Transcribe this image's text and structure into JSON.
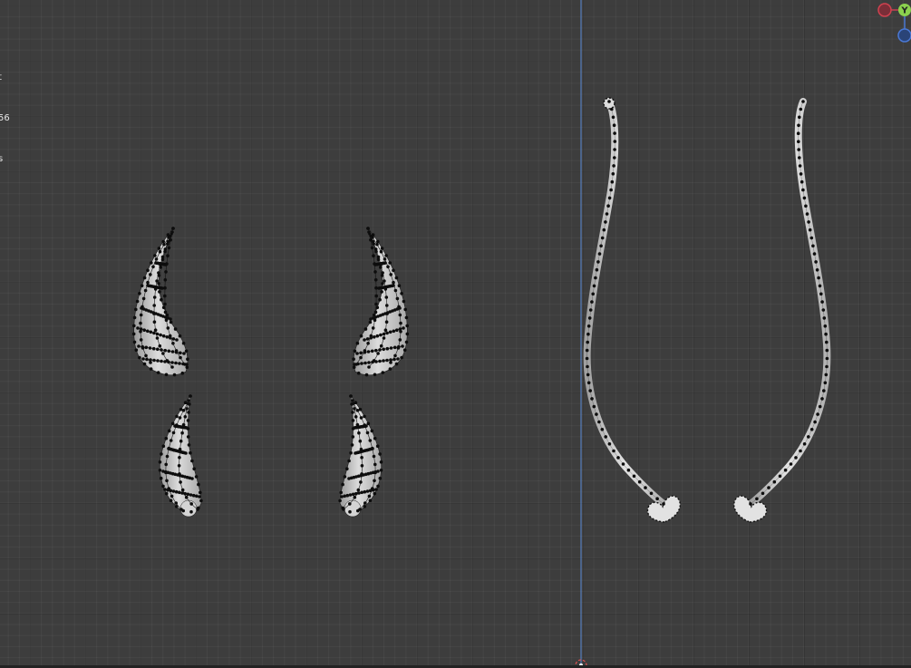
{
  "viewport": {
    "background_color": "#3d3d3d",
    "axis_line_color": "#5a8bd6",
    "view_axis": "Y"
  },
  "stats_overlay": {
    "lines": [
      "t",
      "56",
      "s"
    ]
  },
  "navigation_gizmo": {
    "axis_label": "Y",
    "x_color": "#d0414f",
    "y_color": "#8bd14e",
    "z_color": "#4a78d5"
  },
  "objects": [
    {
      "name": "horn-left-outer",
      "type": "mesh-horn"
    },
    {
      "name": "horn-left-inner",
      "type": "mesh-horn"
    },
    {
      "name": "horn-right-outer",
      "type": "mesh-horn"
    },
    {
      "name": "horn-right-inner",
      "type": "mesh-horn"
    },
    {
      "name": "tail-left",
      "type": "mesh-tail",
      "tip": "heart"
    },
    {
      "name": "tail-right",
      "type": "mesh-tail",
      "tip": "heart"
    }
  ],
  "icons": {
    "origin_marker": "object-origin-icon",
    "gizmo_x": "gizmo-x-axis-icon",
    "gizmo_y": "gizmo-y-axis-icon",
    "gizmo_z": "gizmo-z-axis-icon"
  }
}
